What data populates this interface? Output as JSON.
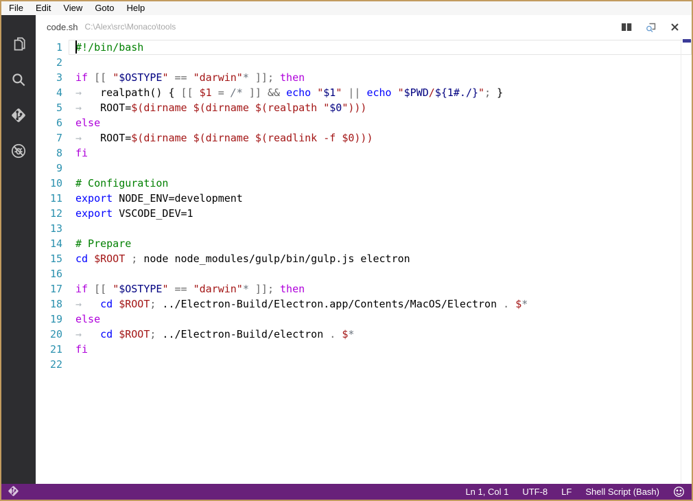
{
  "window": {
    "menu": {
      "items": [
        "File",
        "Edit",
        "View",
        "Goto",
        "Help"
      ]
    }
  },
  "activitybar": {
    "icons": [
      "explorer-icon",
      "search-icon",
      "git-icon",
      "debug-icon"
    ]
  },
  "tab": {
    "file": "code.sh",
    "path": "C:\\Alex\\src\\Monaco\\tools",
    "actions": [
      "split-editor-icon",
      "open-preview-icon",
      "close-icon"
    ]
  },
  "editor": {
    "language": "shell-script",
    "cursor_position": {
      "line": 1,
      "col": 1
    },
    "lines": [
      {
        "n": 1,
        "current": true,
        "cursor": true,
        "t": [
          [
            "c",
            "#!/bin/bash"
          ]
        ]
      },
      {
        "n": 2,
        "t": []
      },
      {
        "n": 3,
        "t": [
          [
            "k",
            "if"
          ],
          [
            "p",
            " "
          ],
          [
            "o",
            "[["
          ],
          [
            "p",
            " "
          ],
          [
            "s",
            "\""
          ],
          [
            "v",
            "$OSTYPE"
          ],
          [
            "s",
            "\""
          ],
          [
            "p",
            " "
          ],
          [
            "o",
            "=="
          ],
          [
            "p",
            " "
          ],
          [
            "s",
            "\"darwin\""
          ],
          [
            "i",
            "*"
          ],
          [
            "p",
            " "
          ],
          [
            "o",
            "]]"
          ],
          [
            "o",
            ";"
          ],
          [
            "p",
            " "
          ],
          [
            "k",
            "then"
          ]
        ]
      },
      {
        "n": 4,
        "t": [
          [
            "t",
            "→"
          ],
          [
            "p",
            "   "
          ],
          [
            "p",
            "realpath() { "
          ],
          [
            "o",
            "[["
          ],
          [
            "p",
            " "
          ],
          [
            "s",
            "$1"
          ],
          [
            "p",
            " "
          ],
          [
            "o",
            "="
          ],
          [
            "p",
            " "
          ],
          [
            "i",
            "/*"
          ],
          [
            "p",
            " "
          ],
          [
            "o",
            "]]"
          ],
          [
            "p",
            " "
          ],
          [
            "o",
            "&&"
          ],
          [
            "p",
            " "
          ],
          [
            "b",
            "echo"
          ],
          [
            "p",
            " "
          ],
          [
            "s",
            "\""
          ],
          [
            "v",
            "$1"
          ],
          [
            "s",
            "\""
          ],
          [
            "p",
            " "
          ],
          [
            "o",
            "||"
          ],
          [
            "p",
            " "
          ],
          [
            "b",
            "echo"
          ],
          [
            "p",
            " "
          ],
          [
            "s",
            "\""
          ],
          [
            "v",
            "$PWD"
          ],
          [
            "s",
            "/"
          ],
          [
            "v",
            "${1#./}"
          ],
          [
            "s",
            "\""
          ],
          [
            "o",
            ";"
          ],
          [
            "p",
            " }"
          ]
        ]
      },
      {
        "n": 5,
        "t": [
          [
            "t",
            "→"
          ],
          [
            "p",
            "   "
          ],
          [
            "p",
            "ROOT="
          ],
          [
            "s",
            "$(dirname $(dirname $(realpath \""
          ],
          [
            "v",
            "$0"
          ],
          [
            "s",
            "\")))"
          ]
        ]
      },
      {
        "n": 6,
        "t": [
          [
            "k",
            "else"
          ]
        ]
      },
      {
        "n": 7,
        "t": [
          [
            "t",
            "→"
          ],
          [
            "p",
            "   "
          ],
          [
            "p",
            "ROOT="
          ],
          [
            "s",
            "$(dirname $(dirname $(readlink -f $0)))"
          ]
        ]
      },
      {
        "n": 8,
        "t": [
          [
            "k",
            "fi"
          ]
        ]
      },
      {
        "n": 9,
        "t": []
      },
      {
        "n": 10,
        "t": [
          [
            "c",
            "# Configuration"
          ]
        ]
      },
      {
        "n": 11,
        "t": [
          [
            "b",
            "export"
          ],
          [
            "p",
            " NODE_ENV=development"
          ]
        ]
      },
      {
        "n": 12,
        "t": [
          [
            "b",
            "export"
          ],
          [
            "p",
            " VSCODE_DEV=1"
          ]
        ]
      },
      {
        "n": 13,
        "t": []
      },
      {
        "n": 14,
        "t": [
          [
            "c",
            "# Prepare"
          ]
        ]
      },
      {
        "n": 15,
        "t": [
          [
            "b",
            "cd"
          ],
          [
            "p",
            " "
          ],
          [
            "s",
            "$ROOT"
          ],
          [
            "p",
            " "
          ],
          [
            "o",
            ";"
          ],
          [
            "p",
            " node node_modules/gulp/bin/gulp.js electron"
          ]
        ]
      },
      {
        "n": 16,
        "t": []
      },
      {
        "n": 17,
        "t": [
          [
            "k",
            "if"
          ],
          [
            "p",
            " "
          ],
          [
            "o",
            "[["
          ],
          [
            "p",
            " "
          ],
          [
            "s",
            "\""
          ],
          [
            "v",
            "$OSTYPE"
          ],
          [
            "s",
            "\""
          ],
          [
            "p",
            " "
          ],
          [
            "o",
            "=="
          ],
          [
            "p",
            " "
          ],
          [
            "s",
            "\"darwin\""
          ],
          [
            "i",
            "*"
          ],
          [
            "p",
            " "
          ],
          [
            "o",
            "]]"
          ],
          [
            "o",
            ";"
          ],
          [
            "p",
            " "
          ],
          [
            "k",
            "then"
          ]
        ]
      },
      {
        "n": 18,
        "t": [
          [
            "t",
            "→"
          ],
          [
            "p",
            "   "
          ],
          [
            "b",
            "cd"
          ],
          [
            "p",
            " "
          ],
          [
            "s",
            "$ROOT"
          ],
          [
            "o",
            ";"
          ],
          [
            "p",
            " ../Electron-Build/Electron.app/Contents/MacOS/Electron "
          ],
          [
            "o",
            "."
          ],
          [
            "p",
            " "
          ],
          [
            "s",
            "$"
          ],
          [
            "i",
            "*"
          ]
        ]
      },
      {
        "n": 19,
        "t": [
          [
            "k",
            "else"
          ]
        ]
      },
      {
        "n": 20,
        "t": [
          [
            "t",
            "→"
          ],
          [
            "p",
            "   "
          ],
          [
            "b",
            "cd"
          ],
          [
            "p",
            " "
          ],
          [
            "s",
            "$ROOT"
          ],
          [
            "o",
            ";"
          ],
          [
            "p",
            " ../Electron-Build/electron "
          ],
          [
            "o",
            "."
          ],
          [
            "p",
            " "
          ],
          [
            "s",
            "$"
          ],
          [
            "i",
            "*"
          ]
        ]
      },
      {
        "n": 21,
        "t": [
          [
            "k",
            "fi"
          ]
        ]
      },
      {
        "n": 22,
        "t": []
      }
    ]
  },
  "statusbar": {
    "items": [
      "Ln 1, Col 1",
      "UTF-8",
      "LF",
      "Shell Script (Bash)"
    ]
  },
  "colors": {
    "window_border": "#c29b5f",
    "activity_bar": "#2d2d30",
    "status_bar": "#68217a",
    "keyword": "#af00db",
    "builtin": "#0000ff",
    "comment": "#008000",
    "string": "#a31515",
    "variable": "#000080",
    "line_number": "#2b91af"
  }
}
